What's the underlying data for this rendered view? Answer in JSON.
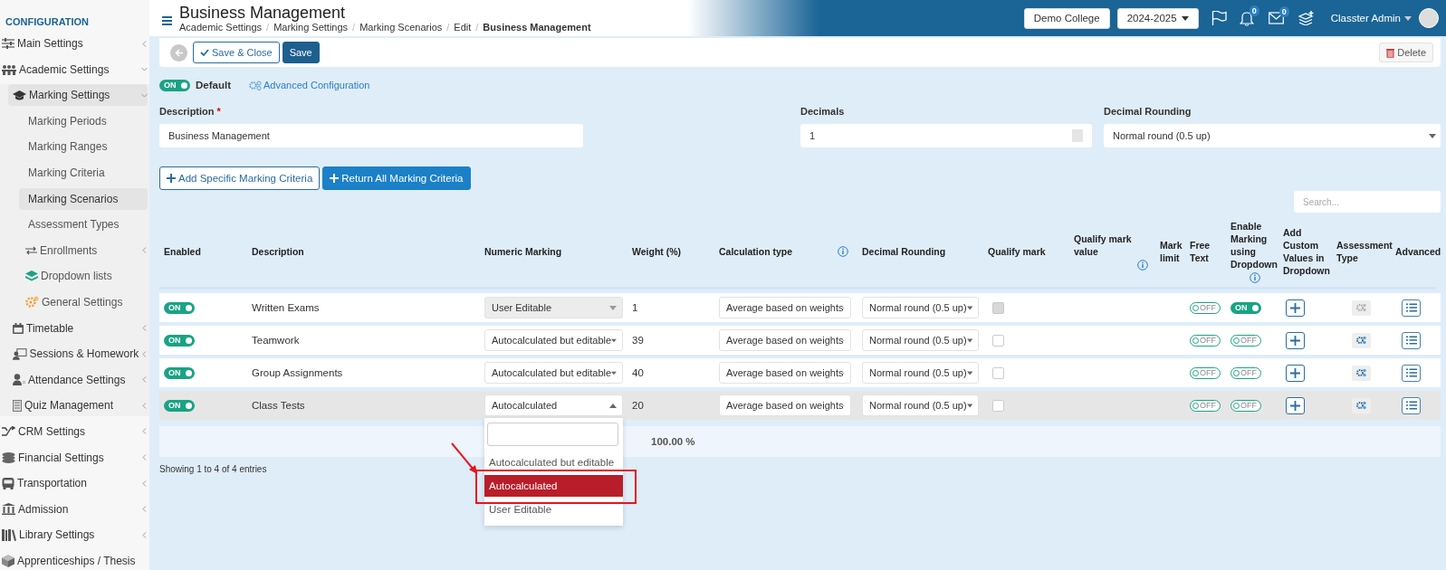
{
  "sidebar": {
    "heading": "CONFIGURATION",
    "items": [
      {
        "label": "Main Settings",
        "kind": "group",
        "expanded": false,
        "selected": false
      },
      {
        "label": "Academic Settings",
        "kind": "group",
        "expanded": true,
        "selected": false,
        "children": [
          {
            "label": "Marking Settings",
            "kind": "group",
            "expanded": true,
            "selected": true,
            "children": [
              {
                "label": "Marking Periods",
                "kind": "link",
                "selected": false
              },
              {
                "label": "Marking Ranges",
                "kind": "link",
                "selected": false
              },
              {
                "label": "Marking Criteria",
                "kind": "link",
                "selected": false
              },
              {
                "label": "Marking Scenarios",
                "kind": "link",
                "selected": true
              },
              {
                "label": "Assessment Types",
                "kind": "link",
                "selected": false
              },
              {
                "label": "Enrollments",
                "kind": "group",
                "expanded": false,
                "selected": false
              },
              {
                "label": "Dropdown lists",
                "kind": "iconlink",
                "selected": false
              },
              {
                "label": "General Settings",
                "kind": "iconlink",
                "selected": false
              }
            ]
          },
          {
            "label": "Timetable",
            "kind": "group",
            "expanded": false,
            "selected": false
          },
          {
            "label": "Sessions & Homework",
            "kind": "group",
            "expanded": false,
            "selected": false
          },
          {
            "label": "Attendance Settings",
            "kind": "group",
            "expanded": false,
            "selected": false
          },
          {
            "label": "Quiz Management",
            "kind": "group",
            "expanded": false,
            "selected": false
          }
        ]
      },
      {
        "label": "CRM Settings",
        "kind": "group",
        "expanded": false,
        "selected": false
      },
      {
        "label": "Financial Settings",
        "kind": "group",
        "expanded": false,
        "selected": false
      },
      {
        "label": "Transportation",
        "kind": "group",
        "expanded": false,
        "selected": false
      },
      {
        "label": "Admission",
        "kind": "group",
        "expanded": false,
        "selected": false
      },
      {
        "label": "Library Settings",
        "kind": "group",
        "expanded": false,
        "selected": false
      },
      {
        "label": "Apprenticeships / Thesis",
        "kind": "iconlink",
        "selected": false
      }
    ]
  },
  "header": {
    "title": "Business Management",
    "breadcrumbs": [
      "Academic Settings",
      "Marking Settings",
      "Marking Scenarios",
      "Edit",
      "Business Management"
    ],
    "breadcrumb_separator": "/",
    "college": "Demo College",
    "year": "2024-2025",
    "notifications": "0",
    "messages": "0",
    "user": "Classter Admin"
  },
  "toolbar": {
    "save_close": "Save & Close",
    "save": "Save",
    "delete": "Delete"
  },
  "default_toggle": {
    "on": true,
    "label": "ON"
  },
  "default_label": "Default",
  "advanced_link": "Advanced Configuration",
  "form": {
    "description": {
      "label": "Description",
      "required": true,
      "required_mark": "*",
      "value": "Business Management"
    },
    "decimals": {
      "label": "Decimals",
      "value": "1"
    },
    "rounding": {
      "label": "Decimal Rounding",
      "value": "Normal round (0.5 up)"
    }
  },
  "actions": [
    "Add Specific Marking Criteria",
    "Return All Marking Criteria"
  ],
  "search": {
    "placeholder": "Search..."
  },
  "table": {
    "columns": [
      {
        "label": "Enabled"
      },
      {
        "label": "Description"
      },
      {
        "label": "Numeric Marking"
      },
      {
        "label": "Weight (%)"
      },
      {
        "label": "Calculation type",
        "info": true
      },
      {
        "label": "Decimal Rounding"
      },
      {
        "label": "Qualify mark"
      },
      {
        "label": "Qualify mark value",
        "info": true
      },
      {
        "label": "Mark limit"
      },
      {
        "label": "Free Text"
      },
      {
        "label": "Enable Marking using Dropdown",
        "info": true
      },
      {
        "label": "Add Custom Values in Dropdown"
      },
      {
        "label": "Assessment Type"
      },
      {
        "label": "Advanced"
      }
    ],
    "rows": [
      {
        "selected": false,
        "enabled": {
          "on": true,
          "label": "ON"
        },
        "description": "Written Exams",
        "numeric_marking": {
          "value": "User Editable",
          "disabled": true,
          "open": false
        },
        "weight": "1",
        "calculation": "Average based on weights",
        "rounding": "Normal round (0.5 up)",
        "qualify_mark": {
          "checked": false,
          "disabled": true
        },
        "free_text": {
          "on": false,
          "label": "OFF"
        },
        "dropdown_marking": {
          "on": true,
          "label": "ON"
        },
        "assessment_disabled": true
      },
      {
        "selected": false,
        "enabled": {
          "on": true,
          "label": "ON"
        },
        "description": "Teamwork",
        "numeric_marking": {
          "value": "Autocalculated but editable",
          "disabled": false,
          "open": false
        },
        "weight": "39",
        "calculation": "Average based on weights",
        "rounding": "Normal round (0.5 up)",
        "qualify_mark": {
          "checked": false,
          "disabled": false
        },
        "free_text": {
          "on": false,
          "label": "OFF"
        },
        "dropdown_marking": {
          "on": false,
          "label": "OFF"
        },
        "assessment_disabled": false
      },
      {
        "selected": false,
        "enabled": {
          "on": true,
          "label": "ON"
        },
        "description": "Group Assignments",
        "numeric_marking": {
          "value": "Autocalculated but editable",
          "disabled": false,
          "open": false
        },
        "weight": "40",
        "calculation": "Average based on weights",
        "rounding": "Normal round (0.5 up)",
        "qualify_mark": {
          "checked": false,
          "disabled": false
        },
        "free_text": {
          "on": false,
          "label": "OFF"
        },
        "dropdown_marking": {
          "on": false,
          "label": "OFF"
        },
        "assessment_disabled": false
      },
      {
        "selected": true,
        "enabled": {
          "on": true,
          "label": "ON"
        },
        "description": "Class Tests",
        "numeric_marking": {
          "value": "Autocalculated",
          "disabled": false,
          "open": true,
          "options": [
            {
              "label": "Autocalculated but editable",
              "selected": false
            },
            {
              "label": "Autocalculated",
              "selected": true,
              "annotated": true
            },
            {
              "label": "User Editable",
              "selected": false
            }
          ]
        },
        "weight": "20",
        "calculation": "Average based on weights",
        "rounding": "Normal round (0.5 up)",
        "qualify_mark": {
          "checked": false,
          "disabled": false
        },
        "free_text": {
          "on": false,
          "label": "OFF"
        },
        "dropdown_marking": {
          "on": false,
          "label": "OFF"
        },
        "assessment_disabled": false
      }
    ],
    "total": "100.00 %",
    "info": "Showing 1 to 4 of 4 entries"
  }
}
